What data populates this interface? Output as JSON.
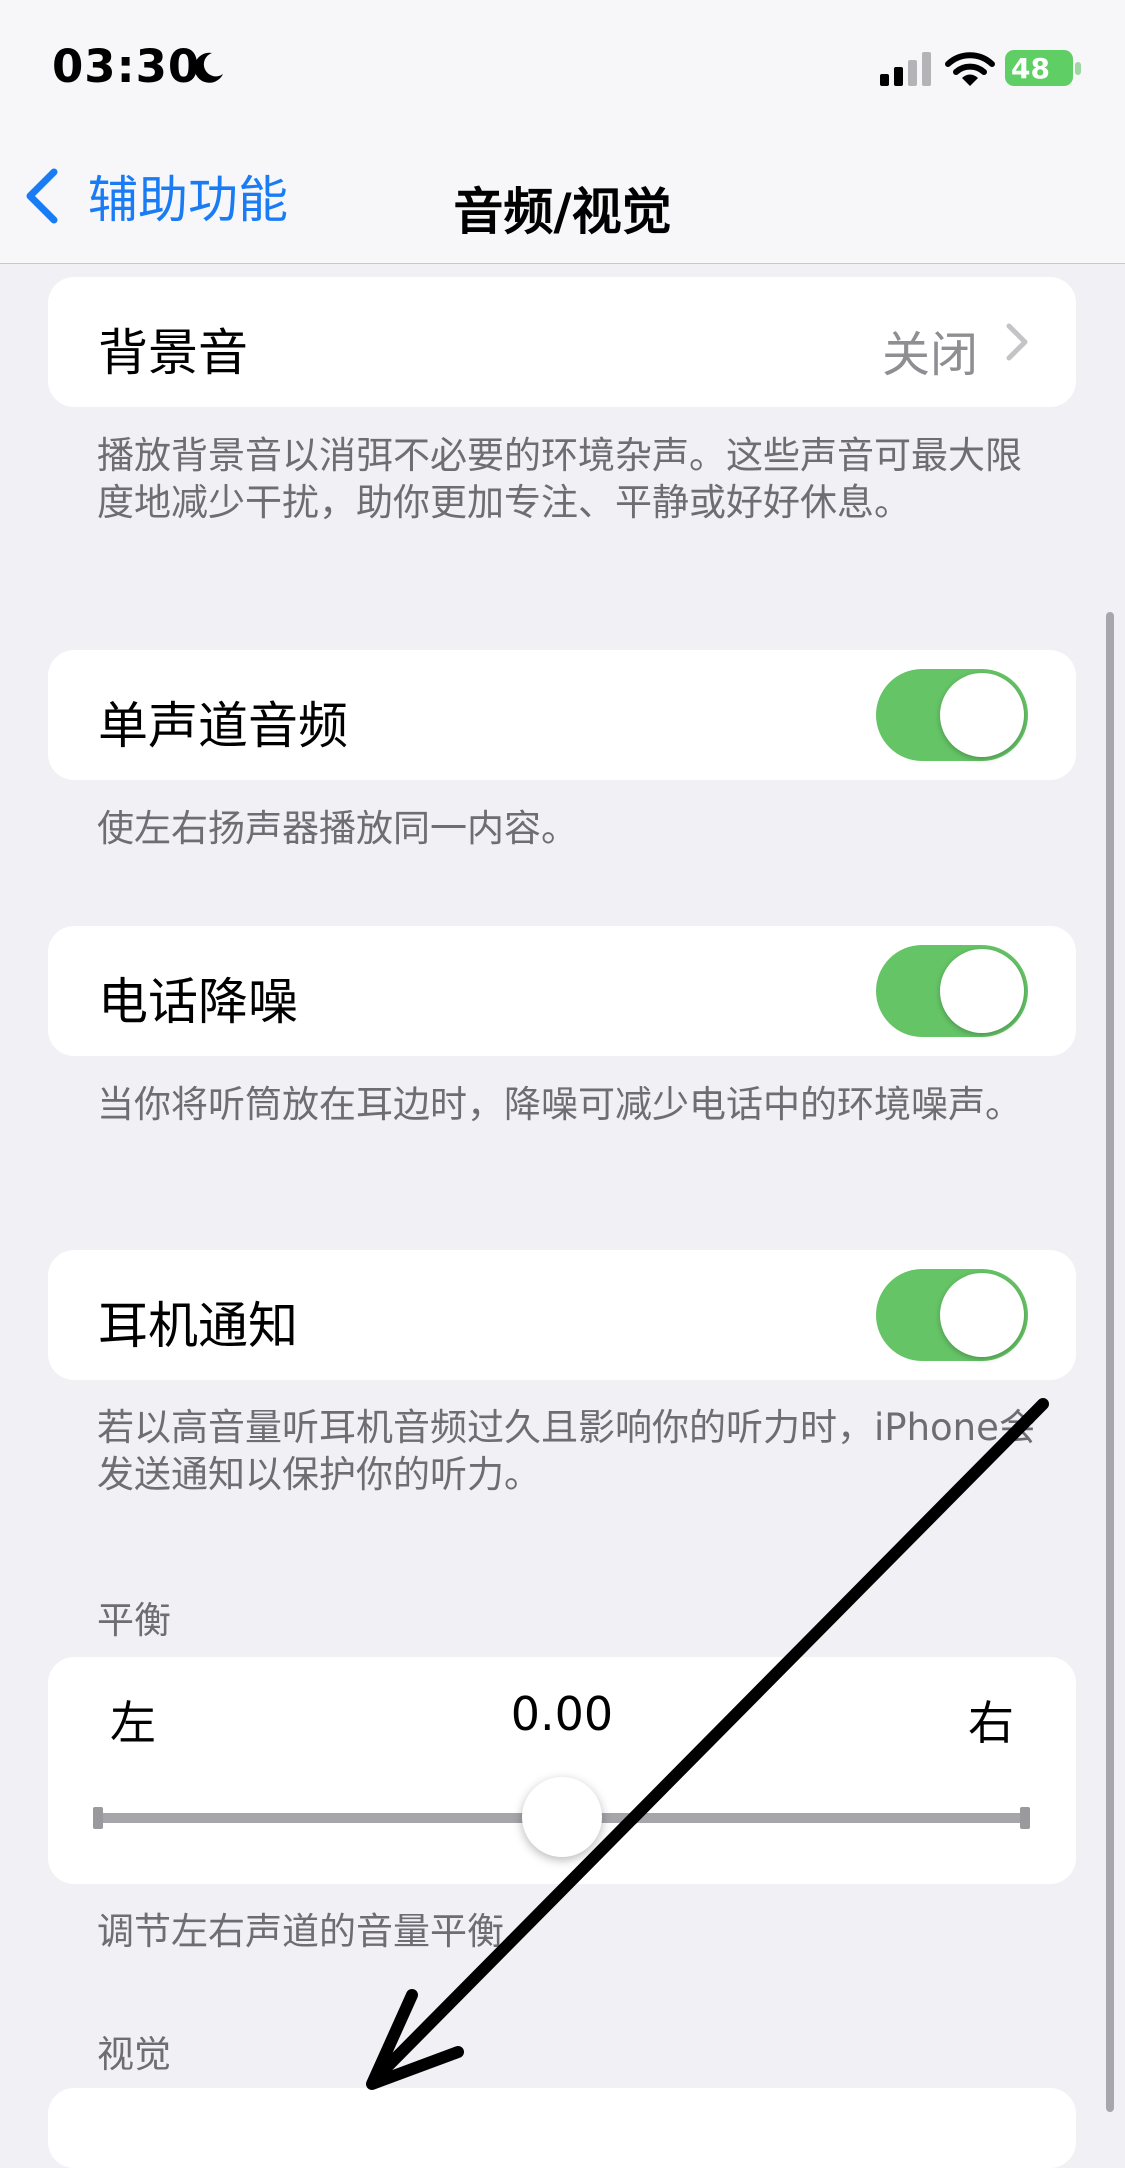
{
  "status_bar": {
    "time": "03:30",
    "battery": "48"
  },
  "nav": {
    "back_label": "辅助功能",
    "title": "音频/视觉"
  },
  "background_sounds": {
    "label": "背景音",
    "value": "关闭",
    "footer": "播放背景音以消弭不必要的环境杂声。这些声音可最大限度地减少干扰，助你更加专注、平静或好好休息。"
  },
  "mono_audio": {
    "label": "单声道音频",
    "on": true,
    "footer": "使左右扬声器播放同一内容。"
  },
  "phone_noise_cancel": {
    "label": "电话降噪",
    "on": true,
    "footer": "当你将听筒放在耳边时，降噪可减少电话中的环境噪声。"
  },
  "headphone_notify": {
    "label": "耳机通知",
    "on": true,
    "footer": "若以高音量听耳机音频过久且影响你的听力时，iPhone会发送通知以保护你的听力。"
  },
  "balance": {
    "section_title": "平衡",
    "left_label": "左",
    "right_label": "右",
    "value": "0.00",
    "slider_fraction": 0.5,
    "footer": "调节左右声道的音量平衡。"
  },
  "visual": {
    "section_title": "视觉"
  },
  "colors": {
    "accent": "#1a7cf5",
    "toggle_on": "#65c466",
    "background": "#f0f0f5"
  },
  "icons": [
    "moon-icon",
    "signal-icon",
    "wifi-icon",
    "battery-icon",
    "back-chevron-icon",
    "chevron-right-icon",
    "arrow-annotation"
  ]
}
